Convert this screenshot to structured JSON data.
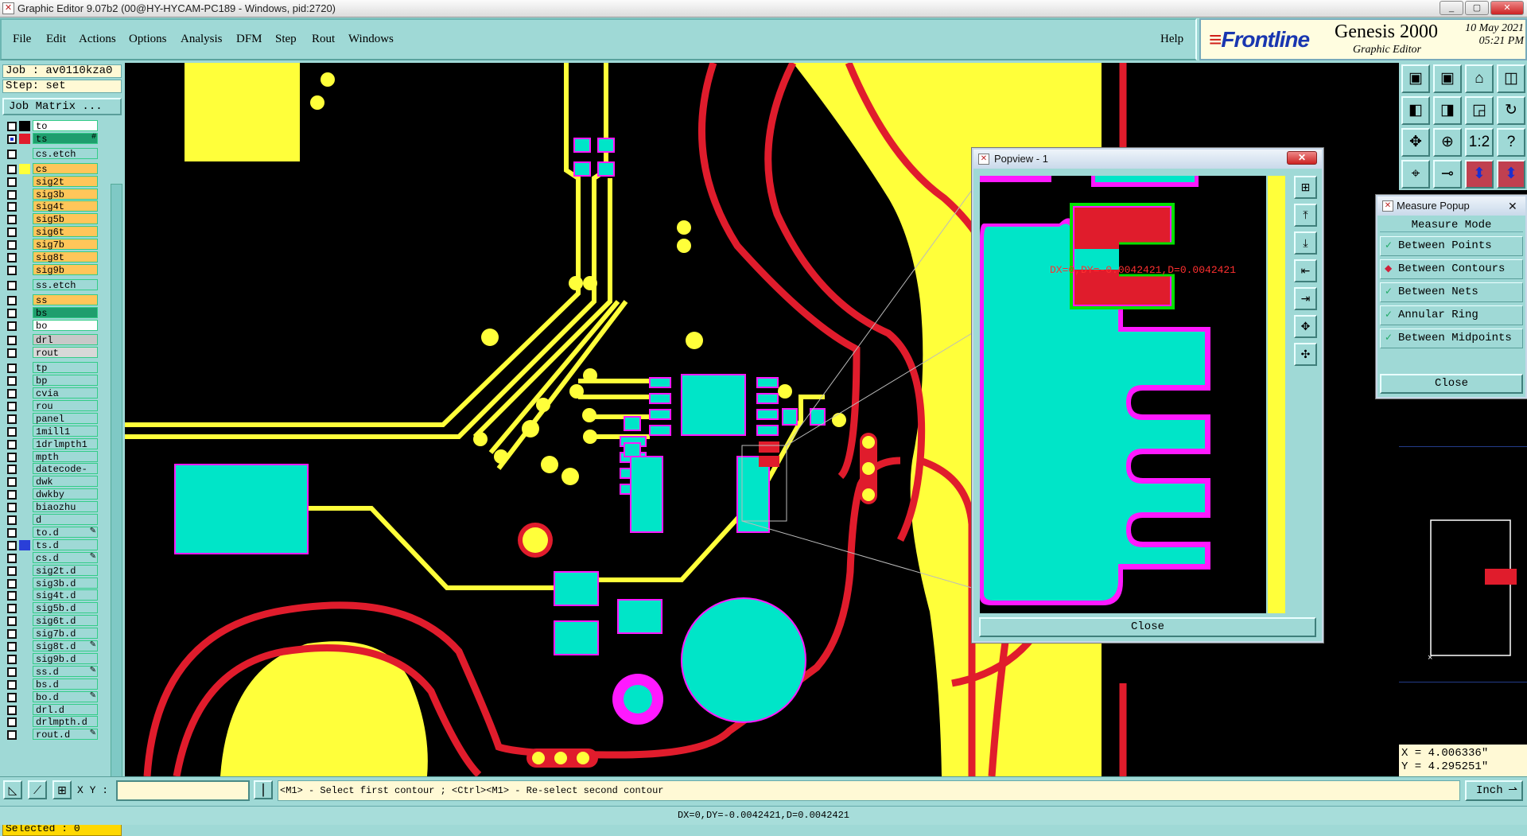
{
  "window": {
    "title": "Graphic Editor 9.07b2 (00@HY-HYCAM-PC189 - Windows, pid:2720)",
    "controls": [
      "_",
      "▢",
      "✕"
    ]
  },
  "menu": {
    "items": [
      "File",
      "Edit",
      "Actions",
      "Options",
      "Analysis",
      "DFM",
      "Step",
      "Rout",
      "Windows"
    ],
    "help": "Help"
  },
  "brand": {
    "logo": "Frontline",
    "product": "Genesis 2000",
    "subtitle": "Graphic Editor",
    "date": "10 May 2021",
    "time": "05:21 PM"
  },
  "job": {
    "job_label": "Job : av0110kza0",
    "step_label": "Step: set",
    "matrix_button": "Job Matrix ..."
  },
  "layers": [
    {
      "name": "to",
      "color": "#ffffff",
      "swatch": "#000000",
      "checked": false
    },
    {
      "name": "ts",
      "color": "#1f9e6e",
      "swatch": "#e01c2c",
      "checked": true,
      "mark": "#"
    },
    {
      "name": "cs.etch",
      "color": "#9fd9d6",
      "swatch": "",
      "checked": false,
      "gap": true
    },
    {
      "name": "cs",
      "color": "#ffc65a",
      "swatch": "#ffff3a",
      "checked": false,
      "gap": true
    },
    {
      "name": "sig2t",
      "color": "#ffc65a",
      "swatch": "",
      "checked": false
    },
    {
      "name": "sig3b",
      "color": "#ffc65a",
      "swatch": "",
      "checked": false
    },
    {
      "name": "sig4t",
      "color": "#ffc65a",
      "swatch": "",
      "checked": false
    },
    {
      "name": "sig5b",
      "color": "#ffc65a",
      "swatch": "",
      "checked": false
    },
    {
      "name": "sig6t",
      "color": "#ffc65a",
      "swatch": "",
      "checked": false
    },
    {
      "name": "sig7b",
      "color": "#ffc65a",
      "swatch": "",
      "checked": false
    },
    {
      "name": "sig8t",
      "color": "#ffc65a",
      "swatch": "",
      "checked": false
    },
    {
      "name": "sig9b",
      "color": "#ffc65a",
      "swatch": "",
      "checked": false
    },
    {
      "name": "ss.etch",
      "color": "#9fd9d6",
      "swatch": "",
      "checked": false,
      "gap": true
    },
    {
      "name": "ss",
      "color": "#ffc65a",
      "swatch": "",
      "checked": false,
      "gap": true
    },
    {
      "name": "bs",
      "color": "#1f9e6e",
      "swatch": "",
      "checked": false
    },
    {
      "name": "bo",
      "color": "#ffffff",
      "swatch": "",
      "checked": false
    },
    {
      "name": "drl",
      "color": "#c8c8c8",
      "swatch": "",
      "checked": false,
      "gap": true
    },
    {
      "name": "rout",
      "color": "#d8d8d8",
      "swatch": "",
      "checked": false
    },
    {
      "name": "tp",
      "color": "#9fd9d6",
      "swatch": "",
      "checked": false,
      "gap": true
    },
    {
      "name": "bp",
      "color": "#9fd9d6",
      "swatch": "",
      "checked": false
    },
    {
      "name": "cvia",
      "color": "#9fd9d6",
      "swatch": "",
      "checked": false
    },
    {
      "name": "rou",
      "color": "#9fd9d6",
      "swatch": "",
      "checked": false
    },
    {
      "name": "panel",
      "color": "#9fd9d6",
      "swatch": "",
      "checked": false
    },
    {
      "name": "1mill1",
      "color": "#9fd9d6",
      "swatch": "",
      "checked": false
    },
    {
      "name": "1drlmpth1",
      "color": "#9fd9d6",
      "swatch": "",
      "checked": false
    },
    {
      "name": "mpth",
      "color": "#9fd9d6",
      "swatch": "",
      "checked": false
    },
    {
      "name": "datecode-pbe",
      "color": "#9fd9d6",
      "swatch": "",
      "checked": false
    },
    {
      "name": "dwk",
      "color": "#9fd9d6",
      "swatch": "",
      "checked": false
    },
    {
      "name": "dwkby",
      "color": "#9fd9d6",
      "swatch": "",
      "checked": false
    },
    {
      "name": "biaozhu",
      "color": "#9fd9d6",
      "swatch": "",
      "checked": false
    },
    {
      "name": "d",
      "color": "#9fd9d6",
      "swatch": "",
      "checked": false
    },
    {
      "name": "to.d",
      "color": "#9fd9d6",
      "swatch": "",
      "checked": false,
      "mark": "✎"
    },
    {
      "name": "ts.d",
      "color": "#9fd9d6",
      "swatch": "#2a3fd8",
      "checked": false
    },
    {
      "name": "cs.d",
      "color": "#9fd9d6",
      "swatch": "",
      "checked": false,
      "mark": "✎"
    },
    {
      "name": "sig2t.d",
      "color": "#9fd9d6",
      "swatch": "",
      "checked": false
    },
    {
      "name": "sig3b.d",
      "color": "#9fd9d6",
      "swatch": "",
      "checked": false
    },
    {
      "name": "sig4t.d",
      "color": "#9fd9d6",
      "swatch": "",
      "checked": false
    },
    {
      "name": "sig5b.d",
      "color": "#9fd9d6",
      "swatch": "",
      "checked": false
    },
    {
      "name": "sig6t.d",
      "color": "#9fd9d6",
      "swatch": "",
      "checked": false
    },
    {
      "name": "sig7b.d",
      "color": "#9fd9d6",
      "swatch": "",
      "checked": false
    },
    {
      "name": "sig8t.d",
      "color": "#9fd9d6",
      "swatch": "",
      "checked": false,
      "mark": "✎"
    },
    {
      "name": "sig9b.d",
      "color": "#9fd9d6",
      "swatch": "",
      "checked": false
    },
    {
      "name": "ss.d",
      "color": "#9fd9d6",
      "swatch": "",
      "checked": false,
      "mark": "✎"
    },
    {
      "name": "bs.d",
      "color": "#9fd9d6",
      "swatch": "",
      "checked": false
    },
    {
      "name": "bo.d",
      "color": "#9fd9d6",
      "swatch": "",
      "checked": false,
      "mark": "✎"
    },
    {
      "name": "drl.d",
      "color": "#9fd9d6",
      "swatch": "",
      "checked": false
    },
    {
      "name": "drlmpth.d",
      "color": "#9fd9d6",
      "swatch": "",
      "checked": false
    },
    {
      "name": "rout.d",
      "color": "#9fd9d6",
      "swatch": "",
      "checked": false,
      "mark": "✎"
    }
  ],
  "selected": "Selected : 0",
  "toolbar": {
    "rows": [
      [
        "pan-up-icon",
        "pan-down-icon",
        "home-icon",
        "window-split-icon"
      ],
      [
        "pan-left-icon",
        "pan-right-icon",
        "zoom-fit-icon",
        "redraw-icon"
      ],
      [
        "zoom-extents-icon",
        "zoom-center-icon",
        "scale-1-2-icon",
        "help-query-icon"
      ],
      [
        "snap-icon",
        "probe-icon",
        "measure-pair-icon",
        "measure-bar-icon"
      ]
    ],
    "glyphs": [
      [
        "▣",
        "▣",
        "⌂",
        "◫"
      ],
      [
        "◧",
        "◨",
        "◲",
        "↻"
      ],
      [
        "✥",
        "⊕",
        "1:2",
        "?"
      ],
      [
        "⌖",
        "⊸",
        "⬍",
        "⬍"
      ]
    ]
  },
  "popview": {
    "title": "Popview - 1",
    "measurement": "DX=0,DY=-0.0042421,D=0.0042421",
    "close": "Close",
    "buttons": [
      "⊞",
      "⤒",
      "⤓",
      "⇤",
      "⇥",
      "✥",
      "✣"
    ],
    "button_names": [
      "popview-zoom-icon",
      "popview-pan-up-icon",
      "popview-pan-down-icon",
      "popview-pan-left-icon",
      "popview-pan-right-icon",
      "popview-fit-icon",
      "popview-center-icon"
    ]
  },
  "measure": {
    "title": "Measure Popup",
    "heading": "Measure Mode",
    "options": [
      "Between Points",
      "Between Contours",
      "Between Nets",
      "Annular Ring",
      "Between Midpoints"
    ],
    "active_index": 1,
    "close": "Close"
  },
  "coords": {
    "x": "X = 4.006336\"",
    "y": "Y = 4.295251\""
  },
  "bottom": {
    "xy_label": "X Y :",
    "xy_value": "",
    "prompt": "<M1> - Select first contour ; <Ctrl><M1> - Re-select second contour",
    "unit": "Inch",
    "status": "DX=0,DY=-0.0042421,D=0.0042421"
  },
  "colors": {
    "trace_yellow": "#ffff3a",
    "pad_cyan": "#00e5c8",
    "rout_red": "#e01c2c",
    "outline_magenta": "#ff19ff",
    "panel_bg": "#9fd9d6"
  }
}
